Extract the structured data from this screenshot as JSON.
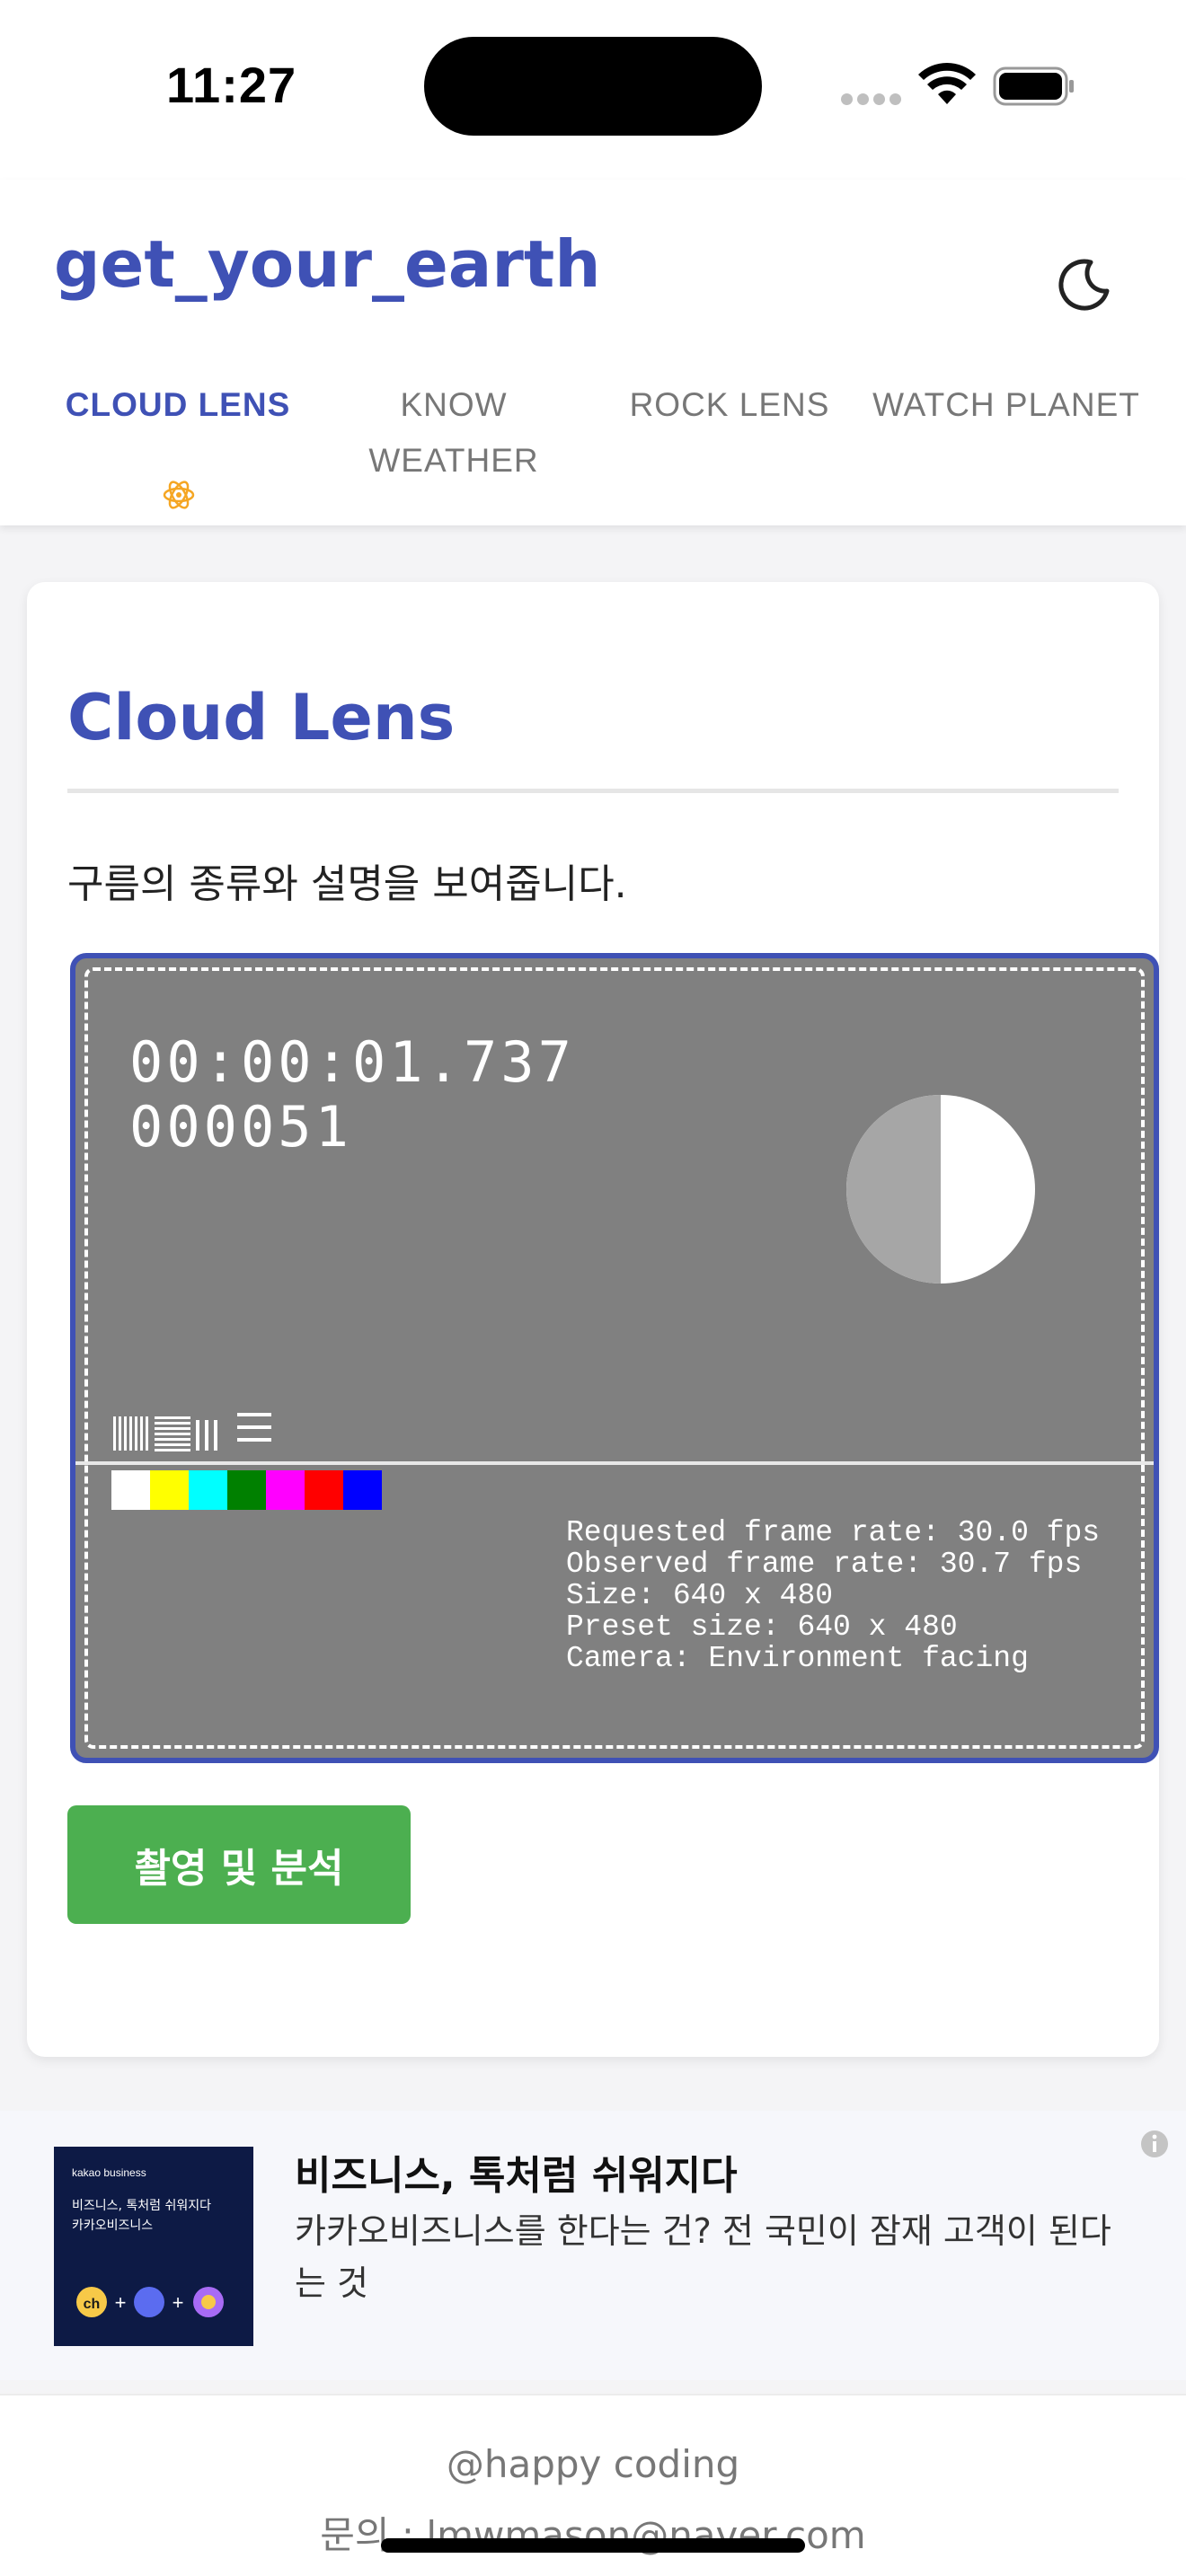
{
  "status_bar": {
    "time": "11:27",
    "icons": [
      "cellular-dots-icon",
      "wifi-icon",
      "battery-icon"
    ]
  },
  "header": {
    "brand": "get_your_earth",
    "theme_toggle_icon": "moon-icon"
  },
  "tabs": [
    {
      "label": "CLOUD LENS",
      "active": true
    },
    {
      "label": "KNOW WEATHER",
      "active": false
    },
    {
      "label": "ROCK LENS",
      "active": false
    },
    {
      "label": "WATCH PLANET",
      "active": false
    }
  ],
  "active_tab_icon": "atom-icon",
  "card": {
    "title": "Cloud Lens",
    "description": "구름의 종류와 설명을 보여줍니다.",
    "camera": {
      "timecode": "00:00:01.737",
      "frame_number": "000051",
      "info_lines": [
        "Requested frame rate: 30.0 fps",
        "Observed frame rate: 30.7 fps",
        "Size: 640 x 480",
        "Preset size: 640 x 480",
        "Camera: Environment facing"
      ],
      "swatch_colors": [
        "#ffffff",
        "#ffff00",
        "#00ffff",
        "#008000",
        "#ff00ff",
        "#ff0000",
        "#0000ff"
      ]
    },
    "capture_button": "촬영 및 분석"
  },
  "ad": {
    "thumb_brand": "kakao business",
    "thumb_lines": [
      "비즈니스, 톡처럼 쉬워지다",
      "카카오비즈니스"
    ],
    "headline": "비즈니스, 톡처럼 쉬워지다",
    "body": "카카오비즈니스를 한다는 건? 전 국민이 잠재 고객이 된다는 것",
    "info_icon": "info-icon"
  },
  "footer": {
    "credit": "@happy coding",
    "contact": "문의 : lmwmason@naver.com"
  },
  "colors": {
    "accent": "#3f51b5",
    "button": "#4caf50",
    "tab_indicator": "#f5a623"
  }
}
